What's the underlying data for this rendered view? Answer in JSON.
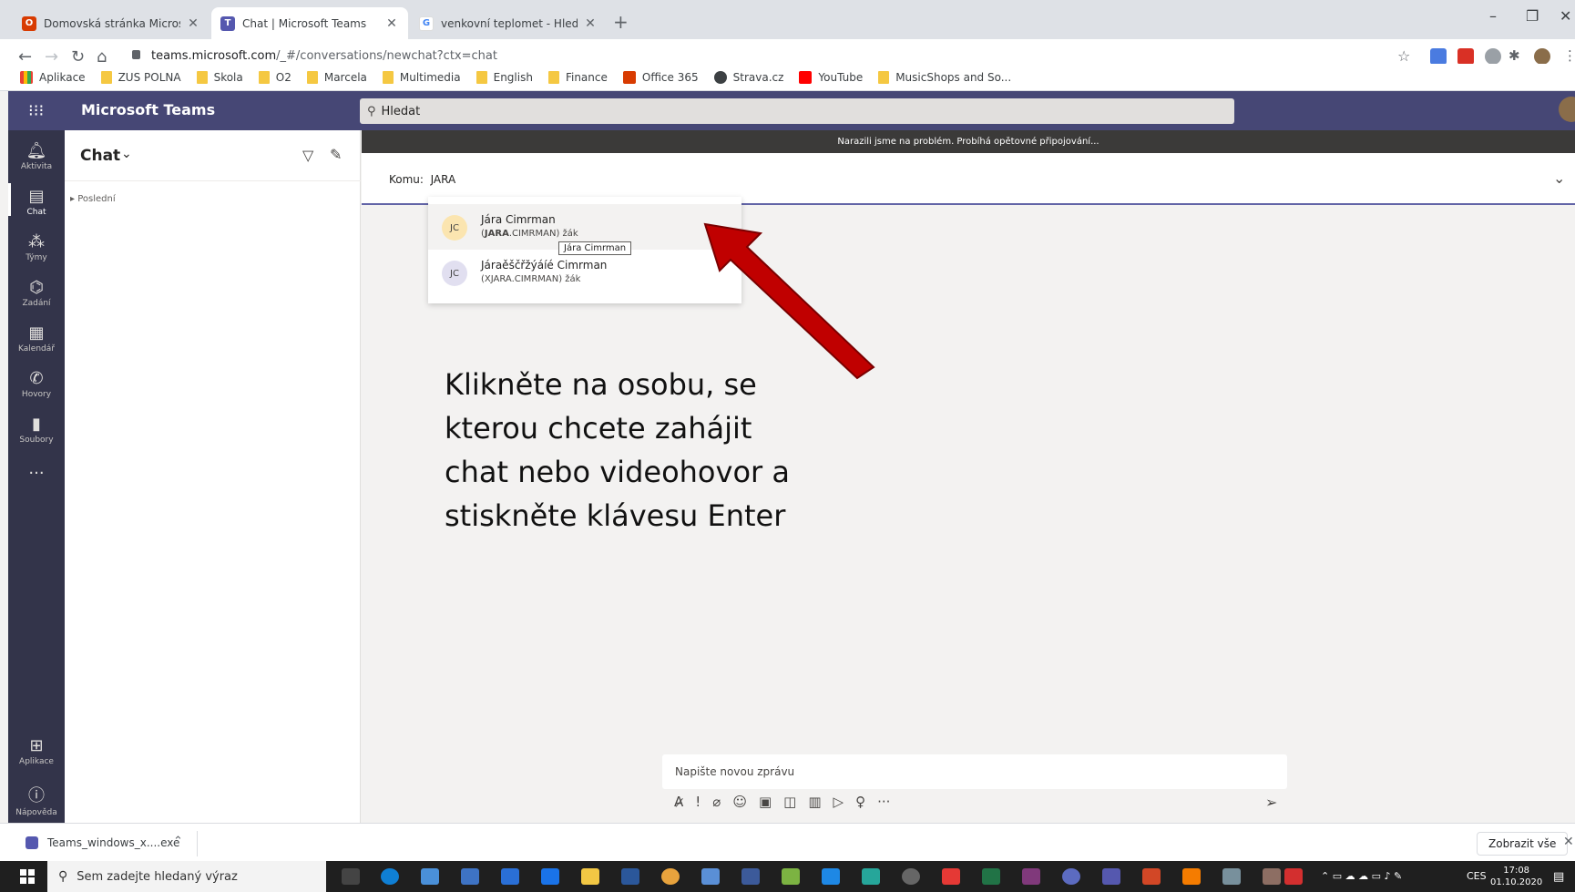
{
  "browser": {
    "tabs": [
      {
        "title": "Domovská stránka Microsoft Offi",
        "icon": "office-icon",
        "color": "#d83b01"
      },
      {
        "title": "Chat | Microsoft Teams",
        "icon": "teams-icon",
        "color": "#5558af"
      },
      {
        "title": "venkovní teplomet - Hledat Goo",
        "icon": "google-icon",
        "color": "#4285f4"
      }
    ],
    "url_host": "teams.microsoft.com",
    "url_path": "/_#/conversations/newchat?ctx=chat",
    "bookmarks": [
      "Aplikace",
      "ZUS POLNA",
      "Skola",
      "O2",
      "Marcela",
      "Multimedia",
      "English",
      "Finance",
      "Office 365",
      "Strava.cz",
      "YouTube",
      "MusicShops and So..."
    ]
  },
  "teams": {
    "app_name": "Microsoft Teams",
    "search_placeholder": "Hledat",
    "rail": [
      {
        "label": "Aktivita",
        "icon": "bell-icon"
      },
      {
        "label": "Chat",
        "icon": "chat-icon"
      },
      {
        "label": "Týmy",
        "icon": "teams-icon"
      },
      {
        "label": "Zadání",
        "icon": "backpack-icon"
      },
      {
        "label": "Kalendář",
        "icon": "calendar-icon"
      },
      {
        "label": "Hovory",
        "icon": "phone-icon"
      },
      {
        "label": "Soubory",
        "icon": "file-icon"
      },
      {
        "label": "Aplikace",
        "icon": "apps-icon"
      },
      {
        "label": "Nápověda",
        "icon": "help-icon"
      }
    ],
    "chat_title": "Chat",
    "recent_label": "Poslední",
    "banner": "Narazili jsme na problém. Probíhá opětovné připojování...",
    "to_label": "Komu:",
    "to_value": "JARA",
    "suggestions": [
      {
        "initials": "JC",
        "name": "Jára Cimrman",
        "sub_bold": "JARA",
        "sub_rest": ".CIMRMAN) žák",
        "sub_open": "(",
        "avatar_color": "#fbe5b0"
      },
      {
        "initials": "JC",
        "name": "Járaěščřžýáíé Cimrman",
        "sub_full": "(XJARA.CIMRMAN) žák",
        "avatar_color": "#e1dff0"
      }
    ],
    "tooltip": "Jára Cimrman",
    "instruction": "Klikněte na osobu, se kterou chcete zahájit chat nebo videohovor a stiskněte klávesu Enter",
    "compose_placeholder": "Napište novou zprávu"
  },
  "downloads": {
    "file": "Teams_windows_x....exe",
    "show_all": "Zobrazit vše"
  },
  "taskbar": {
    "search": "Sem zadejte hledaný výraz",
    "lang": "CES",
    "time": "17:08",
    "date": "01.10.2020"
  },
  "colors": {
    "teams_header": "#464775",
    "rail": "#33344a",
    "arrow": "#c00000"
  }
}
